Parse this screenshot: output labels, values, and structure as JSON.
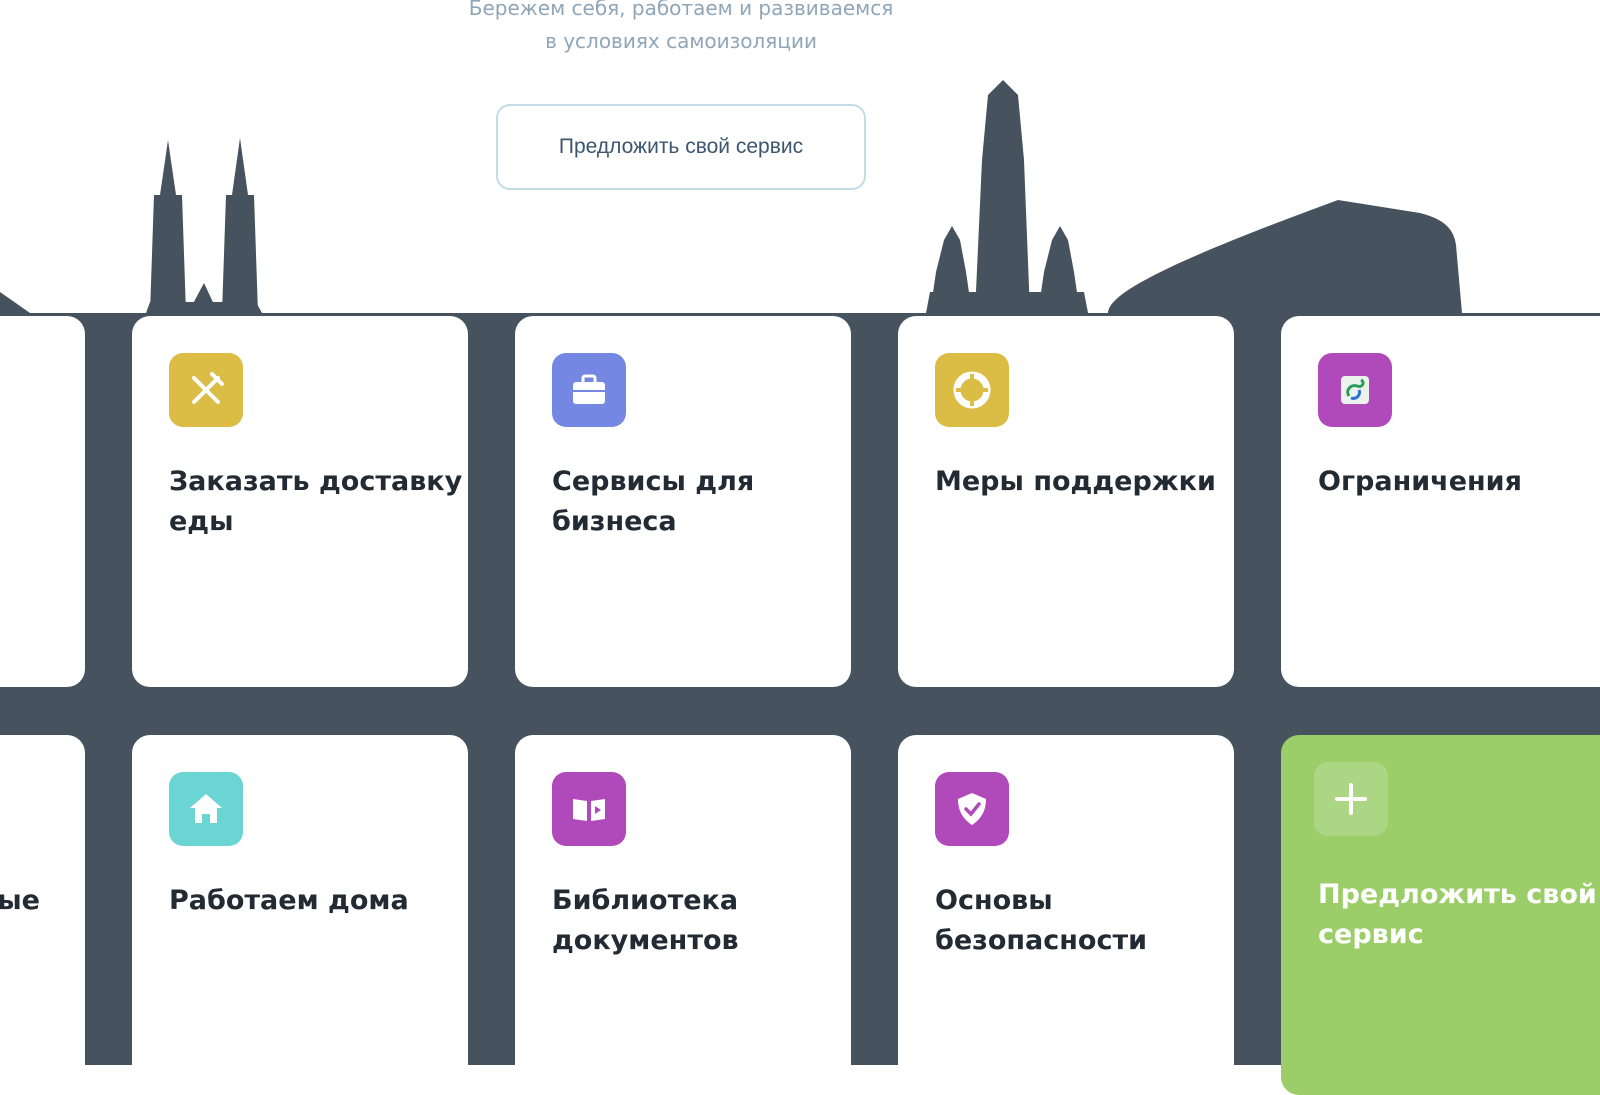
{
  "header": {
    "tagline_line1": "Бережем себя, работаем и развиваемся",
    "tagline_line2": "в условиях самоизоляции",
    "propose_button_label": "Предложить свой сервис"
  },
  "colors": {
    "skyline": "#46535e",
    "card": "#ffffff",
    "accent_green": "#9bcd69"
  },
  "cards": [
    {
      "title": "Заказать доставку еды",
      "icon": "fork-knife-icon",
      "icon_color": "#dbbc45"
    },
    {
      "title": "Сервисы для бизнеса",
      "icon": "briefcase-icon",
      "icon_color": "#7487e2"
    },
    {
      "title": "Меры поддержки",
      "icon": "lifebuoy-icon",
      "icon_color": "#dbbc45"
    },
    {
      "title": "Ограничения",
      "icon": "restrictions-icon",
      "icon_color": "#b04aba"
    },
    {
      "title": "Работаем дома",
      "icon": "home-icon",
      "icon_color": "#6bd5d3"
    },
    {
      "title": "Библиотека документов",
      "icon": "book-play-icon",
      "icon_color": "#b04aba"
    },
    {
      "title": "Основы безопасности",
      "icon": "shield-check-icon",
      "icon_color": "#b04aba"
    },
    {
      "title": "Предложить свой сервис",
      "icon": "plus-icon",
      "icon_color": "#9bcd69"
    }
  ],
  "partial_card_text": "ные"
}
